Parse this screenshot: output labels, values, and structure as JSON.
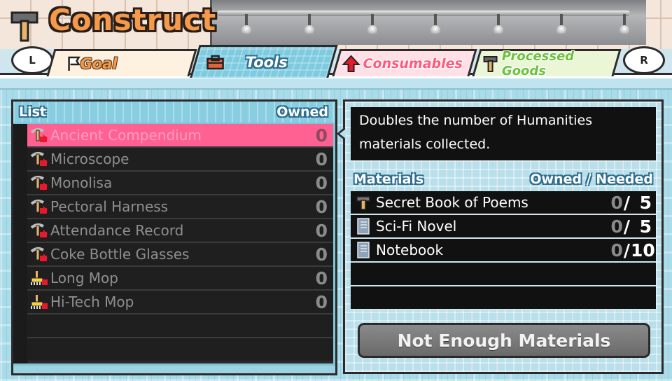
{
  "header": {
    "title": "Construct"
  },
  "tabs": {
    "shoulder_left": "L",
    "shoulder_right": "R",
    "items": [
      {
        "label": "Goal"
      },
      {
        "label": "Tools"
      },
      {
        "label": "Consumables"
      },
      {
        "label": "Processed Goods"
      }
    ],
    "active": "Tools"
  },
  "list": {
    "header_label": "List",
    "owned_label": "Owned",
    "items": [
      {
        "name": "Ancient Compendium",
        "owned": "0",
        "icon": "pickaxe-icon"
      },
      {
        "name": "Microscope",
        "owned": "0",
        "icon": "pickaxe-icon"
      },
      {
        "name": "Monolisa",
        "owned": "0",
        "icon": "pickaxe-icon"
      },
      {
        "name": "Pectoral Harness",
        "owned": "0",
        "icon": "pickaxe-icon"
      },
      {
        "name": "Attendance Record",
        "owned": "0",
        "icon": "pickaxe-icon"
      },
      {
        "name": "Coke Bottle Glasses",
        "owned": "0",
        "icon": "pickaxe-icon"
      },
      {
        "name": "Long Mop",
        "owned": "0",
        "icon": "mop-icon"
      },
      {
        "name": "Hi-Tech Mop",
        "owned": "0",
        "icon": "mop-icon"
      }
    ],
    "selected_index": 0
  },
  "detail": {
    "description": "Doubles the number of Humanities materials collected.",
    "materials_label": "Materials",
    "owned_needed_label": "Owned / Needed",
    "materials": [
      {
        "name": "Secret Book of Poems",
        "owned": "0",
        "needed": "5",
        "icon": "hammer-icon"
      },
      {
        "name": "Sci-Fi Novel",
        "owned": "0",
        "needed": "5",
        "icon": "book-icon"
      },
      {
        "name": "Notebook",
        "owned": "0",
        "needed": "10",
        "icon": "book-icon"
      }
    ],
    "button_label": "Not Enough Materials"
  },
  "colors": {
    "selected_row": "#ff6193",
    "title": "#f49a4a",
    "panel_plaid": "#a9dbe9"
  }
}
